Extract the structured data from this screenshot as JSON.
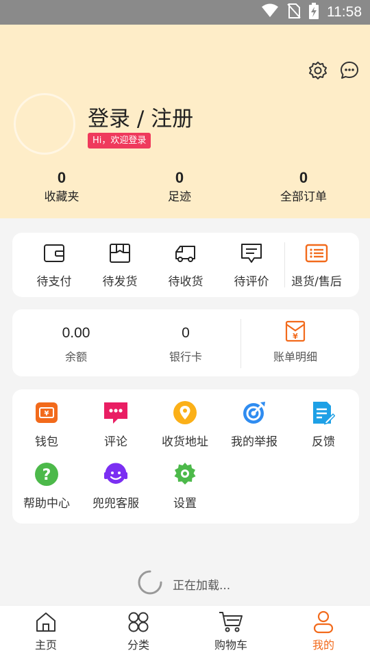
{
  "status_bar": {
    "time": "11:58"
  },
  "header": {
    "login_title": "登录 / 注册",
    "welcome_badge": "Hi，欢迎登录",
    "stats": [
      {
        "value": "0",
        "label": "收藏夹"
      },
      {
        "value": "0",
        "label": "足迹"
      },
      {
        "value": "0",
        "label": "全部订单"
      }
    ]
  },
  "orders": [
    {
      "label": "待支付",
      "icon": "wallet-icon"
    },
    {
      "label": "待发货",
      "icon": "box-icon"
    },
    {
      "label": "待收货",
      "icon": "truck-icon"
    },
    {
      "label": "待评价",
      "icon": "comment-icon"
    },
    {
      "label": "退货/售后",
      "icon": "return-list-icon"
    }
  ],
  "finance": {
    "balance": {
      "value": "0.00",
      "label": "余额"
    },
    "bank_card": {
      "value": "0",
      "label": "银行卡"
    },
    "bill": {
      "label": "账单明细",
      "icon": "bill-icon"
    }
  },
  "services": [
    {
      "label": "钱包",
      "icon": "wallet-orange-icon"
    },
    {
      "label": "评论",
      "icon": "review-icon"
    },
    {
      "label": "收货地址",
      "icon": "location-icon"
    },
    {
      "label": "我的举报",
      "icon": "target-icon"
    },
    {
      "label": "反馈",
      "icon": "feedback-icon"
    },
    {
      "label": "帮助中心",
      "icon": "help-icon"
    },
    {
      "label": "兜兜客服",
      "icon": "customer-service-icon"
    },
    {
      "label": "设置",
      "icon": "settings-gear-icon"
    }
  ],
  "loading_text": "正在加载...",
  "bottom_nav": [
    {
      "label": "主页",
      "icon": "home-icon"
    },
    {
      "label": "分类",
      "icon": "category-icon"
    },
    {
      "label": "购物车",
      "icon": "cart-icon"
    },
    {
      "label": "我的",
      "icon": "profile-icon",
      "active": true
    }
  ],
  "colors": {
    "header_bg": "#feedc8",
    "accent": "#f26a1b",
    "badge": "#ef3a5c"
  }
}
